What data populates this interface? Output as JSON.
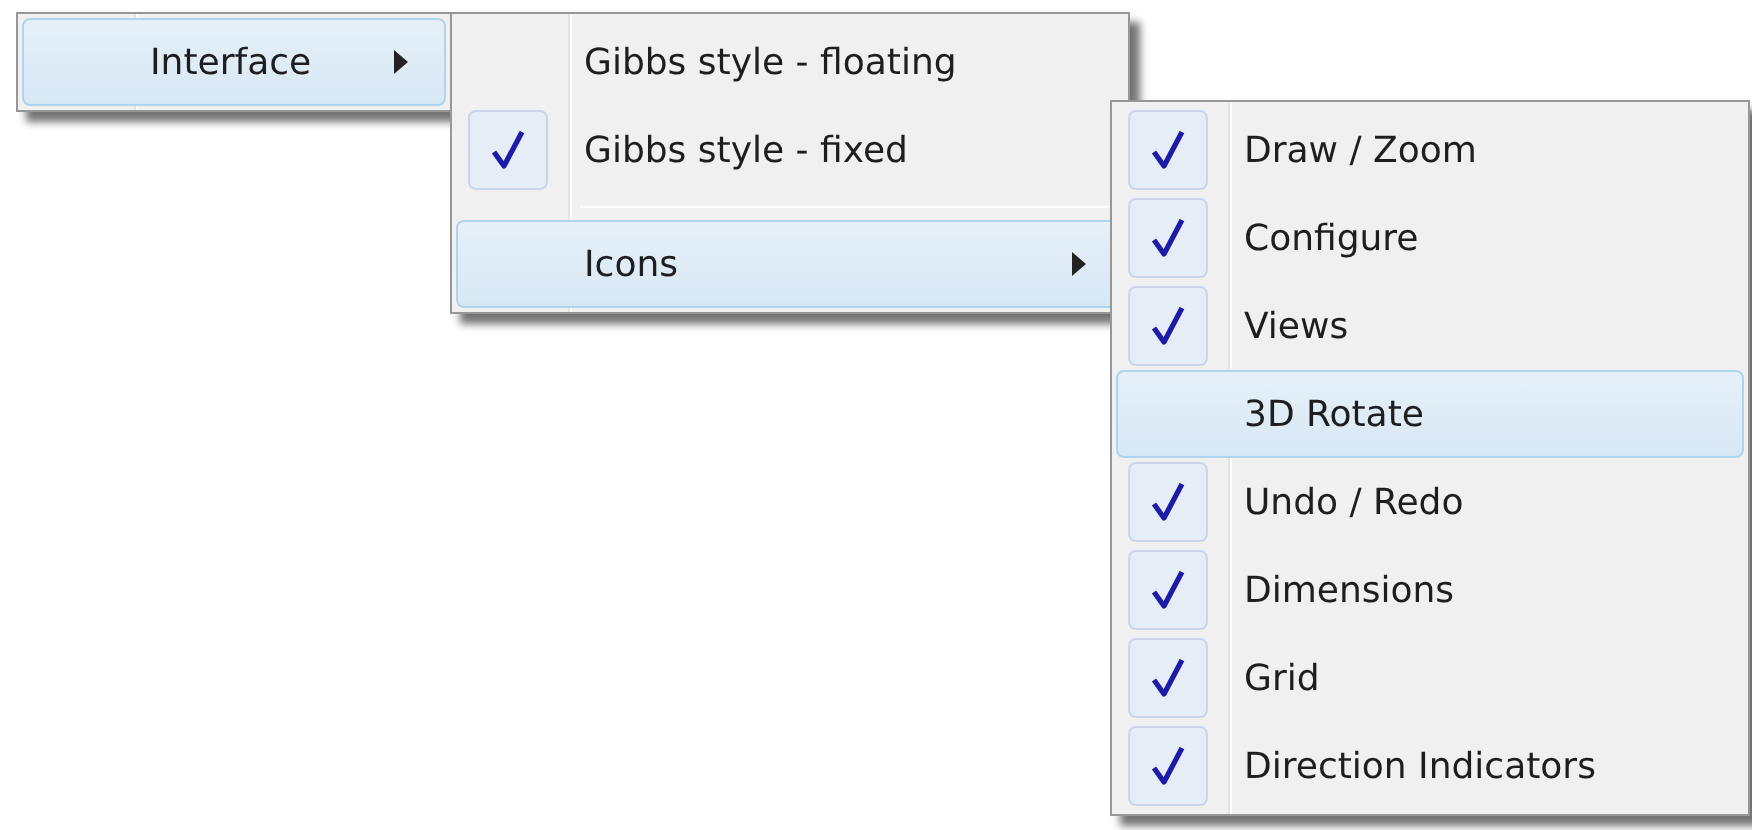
{
  "menus": [
    {
      "items": [
        {
          "kind": "submenu",
          "label": "Interface",
          "selected": true,
          "checked": false
        }
      ]
    },
    {
      "items": [
        {
          "kind": "item",
          "label": "Gibbs style - floating",
          "selected": false,
          "checked": false
        },
        {
          "kind": "item",
          "label": "Gibbs style - fixed",
          "selected": false,
          "checked": true
        },
        {
          "kind": "separator"
        },
        {
          "kind": "submenu",
          "label": "Icons",
          "selected": true,
          "checked": false
        }
      ]
    },
    {
      "items": [
        {
          "kind": "item",
          "label": "Draw / Zoom",
          "selected": false,
          "checked": true
        },
        {
          "kind": "item",
          "label": "Configure",
          "selected": false,
          "checked": true
        },
        {
          "kind": "item",
          "label": "Views",
          "selected": false,
          "checked": true
        },
        {
          "kind": "item",
          "label": "3D Rotate",
          "selected": true,
          "checked": false
        },
        {
          "kind": "item",
          "label": "Undo / Redo",
          "selected": false,
          "checked": true
        },
        {
          "kind": "item",
          "label": "Dimensions",
          "selected": false,
          "checked": true
        },
        {
          "kind": "item",
          "label": "Grid",
          "selected": false,
          "checked": true
        },
        {
          "kind": "item",
          "label": "Direction Indicators",
          "selected": false,
          "checked": true
        }
      ]
    }
  ]
}
